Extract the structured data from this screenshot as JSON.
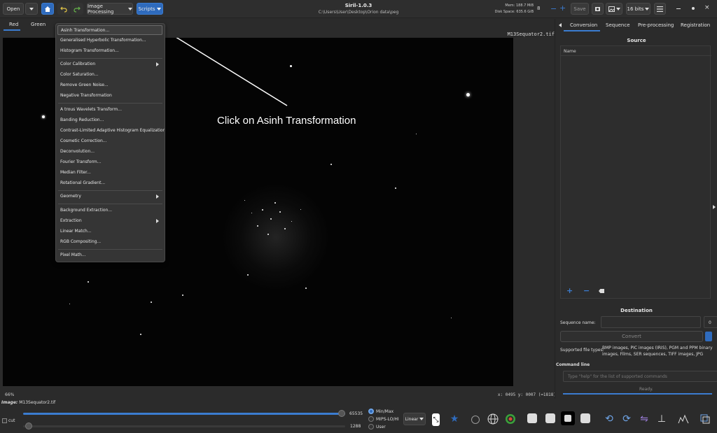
{
  "toolbar": {
    "open_label": "Open",
    "image_processing_label": "Image Processing",
    "scripts_label": "Scripts",
    "save_label": "Save",
    "bits_label": "16 bits",
    "app_title": "Siril-1.0.3",
    "path": "C:\\Users\\User\\Desktop\\Orion data\\peg",
    "mem": "Mem: 188.7 MiB",
    "disk": "Disk Space: 635.6 GiB",
    "thread_count": "8"
  },
  "image_tabs": [
    "Red",
    "Green"
  ],
  "filename_label": "M13Sequator2.tif",
  "menu": {
    "groups": [
      [
        "Asinh Transformation...",
        "Generalised Hyperbolic Transformation...",
        "Histogram Transformation..."
      ],
      [
        "Color Calibration",
        "Color Saturation...",
        "Remove Green Noise...",
        "Negative Transformation"
      ],
      [
        "A trous Wavelets Transform...",
        "Banding Reduction...",
        "Contrast-Limited Adaptive Histogram Equalization...",
        "Cosmetic Correction...",
        "Deconvolution...",
        "Fourier Transform...",
        "Median Filter...",
        "Rotational Gradient..."
      ],
      [
        "Geometry"
      ],
      [
        "Background Extraction...",
        "Extraction",
        "Linear Match...",
        "RGB Compositing..."
      ],
      [
        "Pixel Math..."
      ]
    ]
  },
  "annotation": "Click on Asinh Transformation",
  "status": {
    "zoom": "66%",
    "coords": "x: 0495 y: 0007 (=1818)"
  },
  "right_panel": {
    "tabs": [
      "Conversion",
      "Sequence",
      "Pre-processing",
      "Registration"
    ],
    "source_title": "Source",
    "name_header": "Name",
    "destination_title": "Destination",
    "sequence_name_label": "Sequence name:",
    "sequence_number": "0",
    "convert_label": "Convert",
    "supported_label": "Supported file types:",
    "supported_text": "BMP images, PIC images (IRIS), PGM and PPM binary images, Films, SER sequences, TIFF images, JPG images,",
    "command_line_title": "Command line",
    "command_placeholder": "Type \"help\" for the list of supported commands",
    "ready_text": "Ready."
  },
  "bottom": {
    "image_label": "Image:",
    "image_name": "M13Sequator2.tif",
    "cut_label": "cut",
    "high_value": "65535",
    "low_value": "1288",
    "modes": [
      "Min/Max",
      "MIPS-LO/HI",
      "User"
    ],
    "selected_mode": "Min/Max",
    "stretch": "Linear"
  },
  "colors": {
    "accent": "#2f6bbd",
    "bg": "#2b2b2b",
    "canvas": "#040404"
  }
}
